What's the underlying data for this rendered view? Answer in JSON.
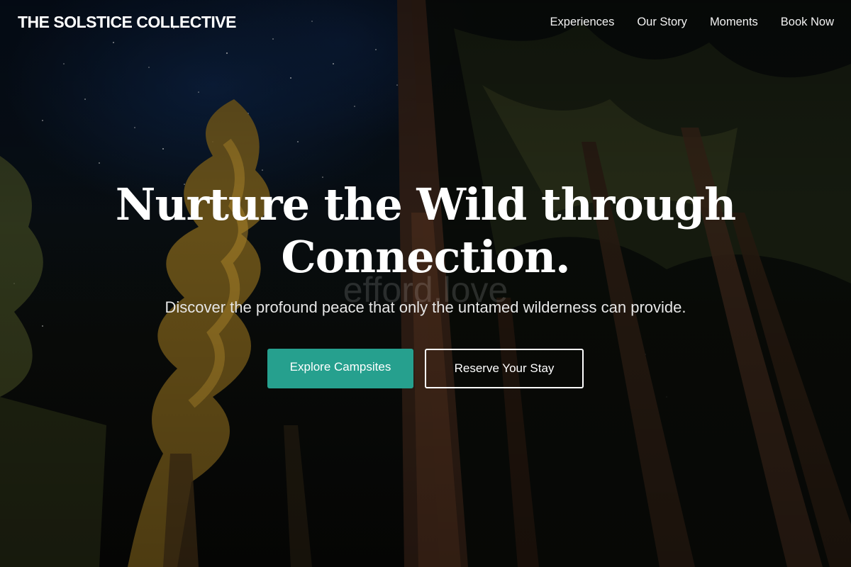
{
  "brand": {
    "name": "THE SOLSTICE COLLECTIVE"
  },
  "nav": {
    "items": [
      {
        "label": "Experiences"
      },
      {
        "label": "Our Story"
      },
      {
        "label": "Moments"
      },
      {
        "label": "Book Now"
      }
    ]
  },
  "hero": {
    "headline_line1": "Nurture the Wild through",
    "headline_line2": "Connection.",
    "subheadline": "Discover the profound peace that only the untamed wilderness can provide.",
    "watermark": "efford.love",
    "primary_cta": "Explore Campsites",
    "secondary_cta": "Reserve Your Stay"
  },
  "colors": {
    "accent": "#26a08e",
    "text": "#ffffff",
    "background": "#05080c"
  }
}
